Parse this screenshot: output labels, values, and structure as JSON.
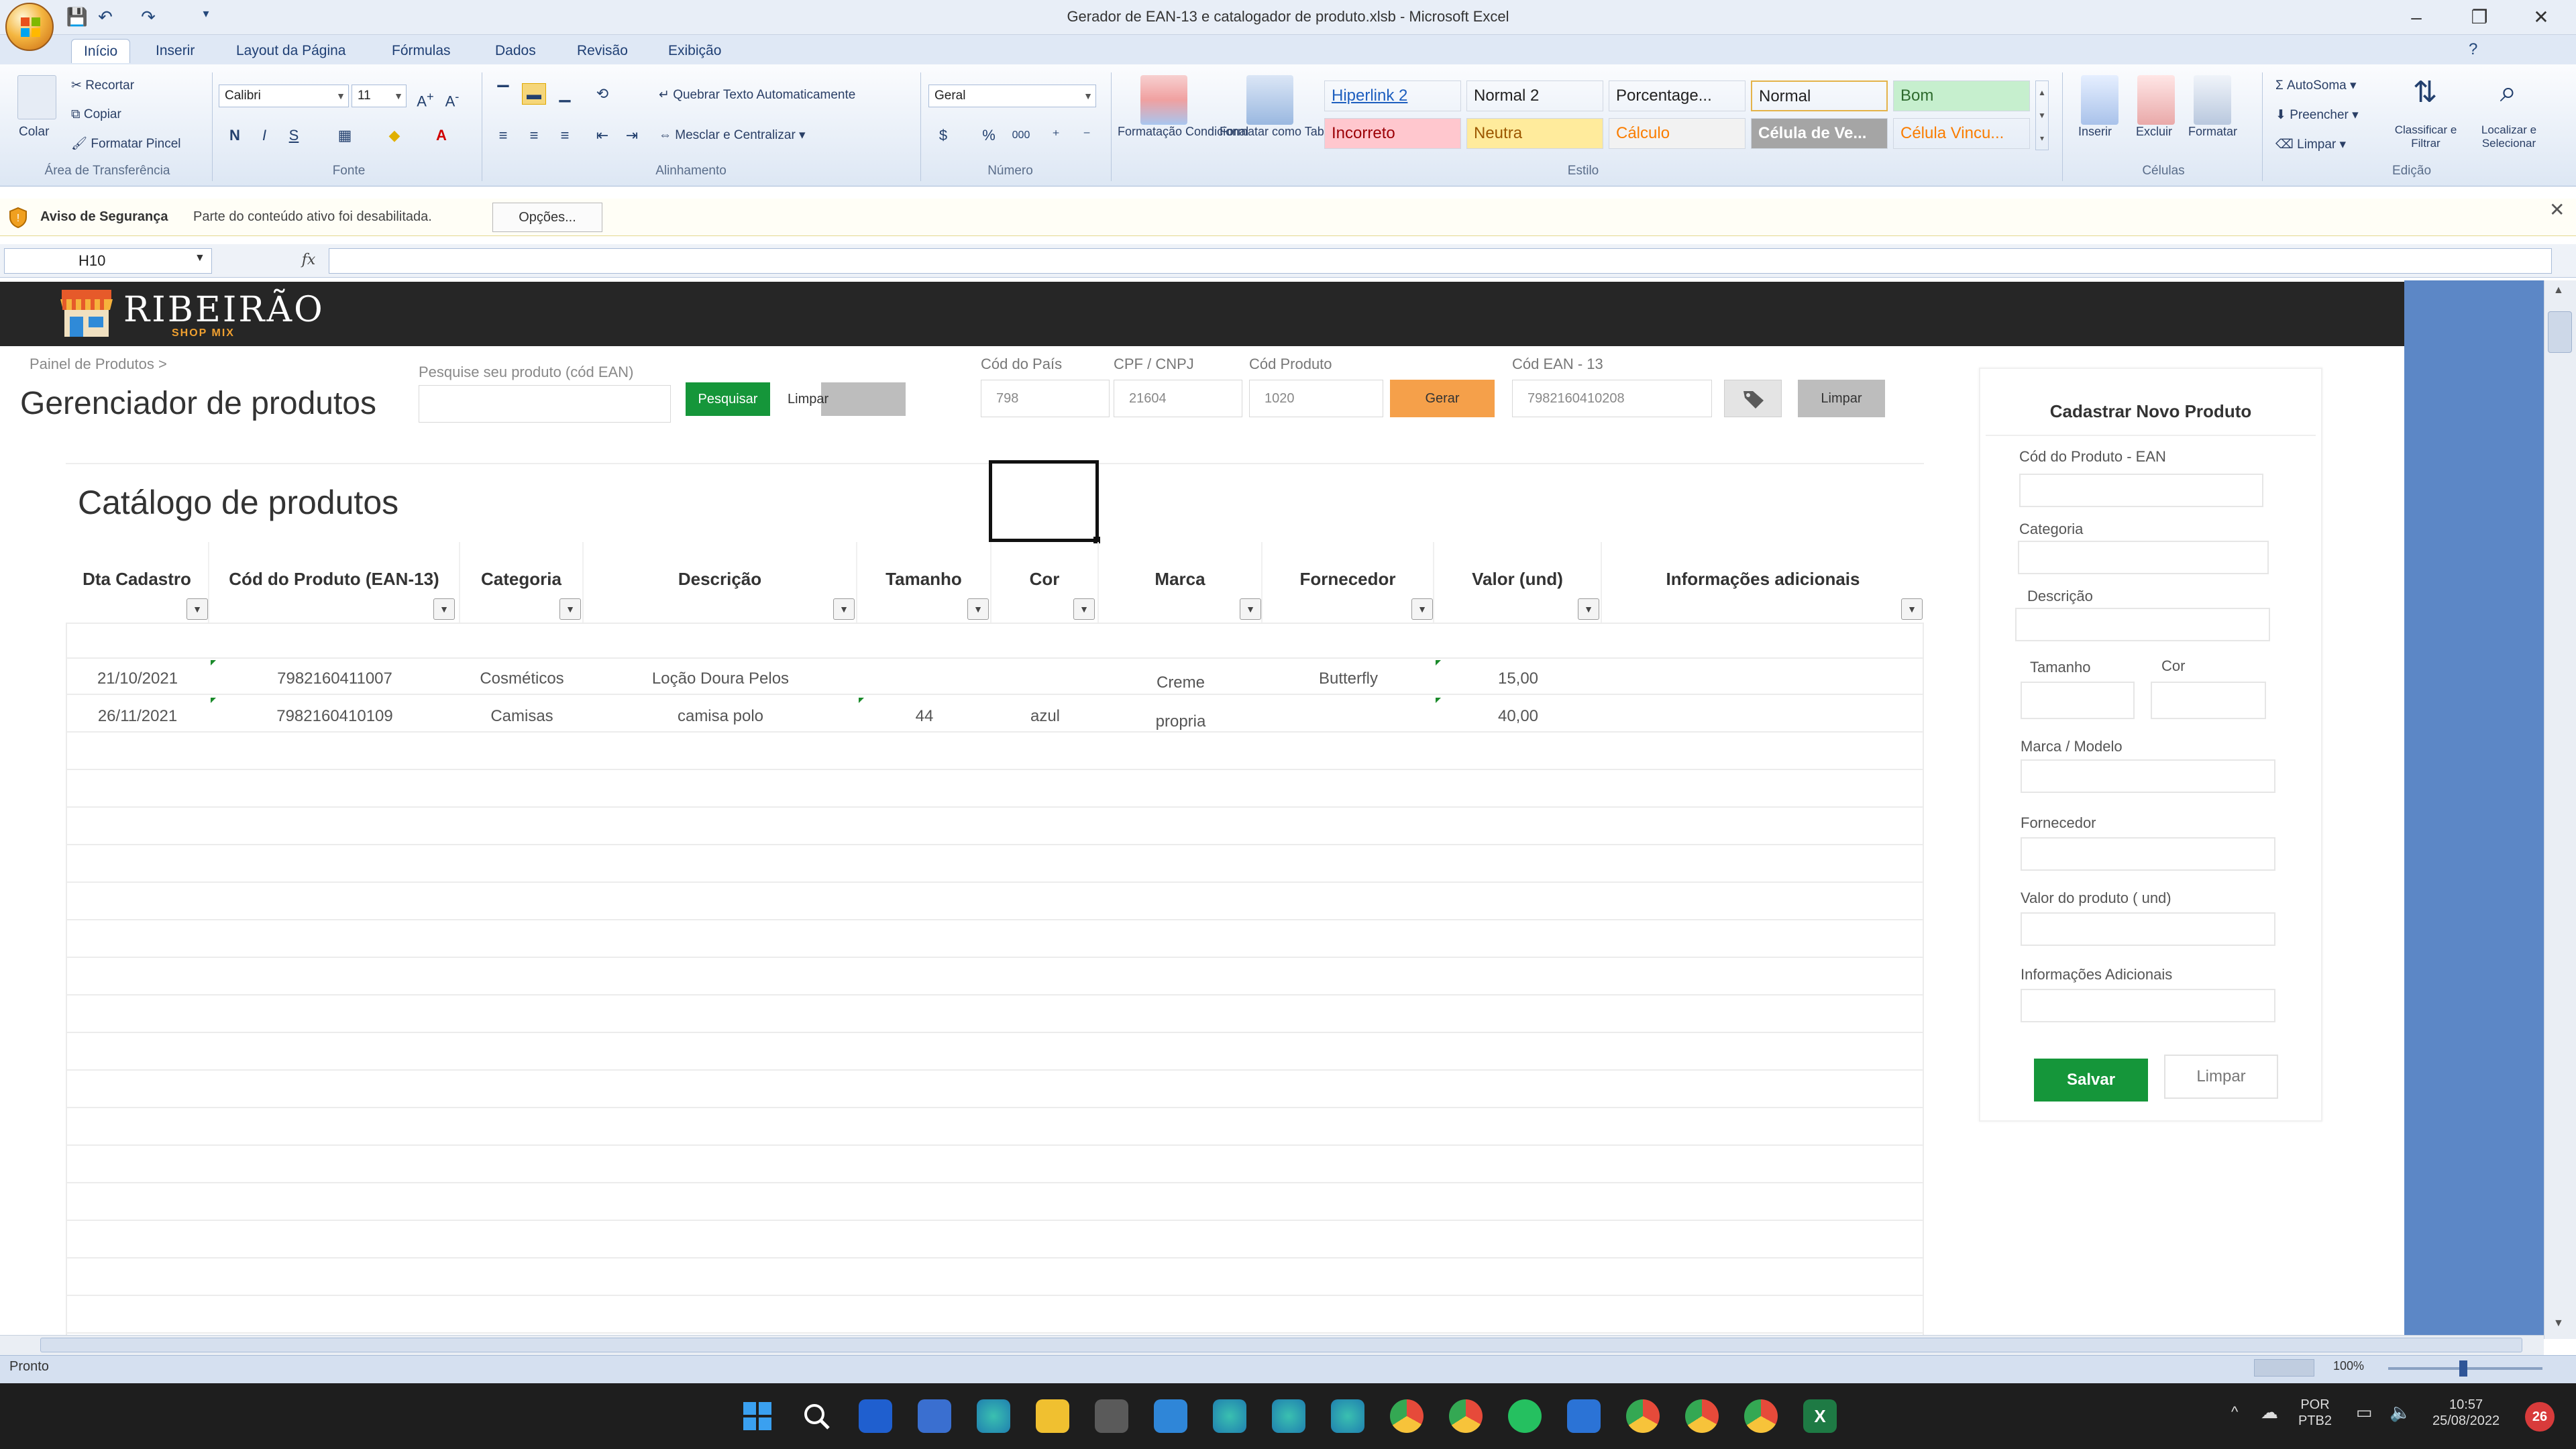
{
  "window": {
    "title": "Gerador de EAN-13 e catalogador de produto.xlsb - Microsoft Excel",
    "minimize": "–",
    "restore": "❐",
    "close": "✕"
  },
  "menu": {
    "tabs": [
      "Início",
      "Inserir",
      "Layout da Página",
      "Fórmulas",
      "Dados",
      "Revisão",
      "Exibição"
    ],
    "active_index": 0
  },
  "ribbon": {
    "clipboard": {
      "paste": "Colar",
      "cut": "Recortar",
      "copy": "Copiar",
      "format_painter": "Formatar Pincel",
      "group": "Área de Transferência"
    },
    "font": {
      "name": "Calibri",
      "size": "11",
      "group": "Fonte",
      "bold": "N",
      "italic": "I",
      "underline": "S"
    },
    "alignment": {
      "wrap": "Quebrar Texto Automaticamente",
      "merge": "Mesclar e Centralizar",
      "group": "Alinhamento"
    },
    "number": {
      "format": "Geral",
      "currency": "$",
      "percent": "%",
      "thousands": "000",
      "group": "Número"
    },
    "styles": {
      "conditional": "Formatação Condicional",
      "as_table": "Formatar como Tabela",
      "items": [
        {
          "label": "Hiperlink 2",
          "bg": "#ffffff",
          "fg": "#1e5fbf"
        },
        {
          "label": "Normal 2",
          "bg": "#ffffff",
          "fg": "#222222"
        },
        {
          "label": "Porcentage...",
          "bg": "#ffffff",
          "fg": "#222222"
        },
        {
          "label": "Normal",
          "bg": "#ffffff",
          "fg": "#222222"
        },
        {
          "label": "Bom",
          "bg": "#c6efce",
          "fg": "#2e6b2e"
        },
        {
          "label": "Incorreto",
          "bg": "#ffc7ce",
          "fg": "#9c0006"
        },
        {
          "label": "Neutra",
          "bg": "#ffeb9c",
          "fg": "#9c5700"
        },
        {
          "label": "Cálculo",
          "bg": "#f2f2f2",
          "fg": "#fa7d00"
        },
        {
          "label": "Célula de Ve...",
          "bg": "#a5a5a5",
          "fg": "#ffffff"
        },
        {
          "label": "Célula Vincu...",
          "bg": "#ffffff",
          "fg": "#fa7d00"
        }
      ],
      "group": "Estilo"
    },
    "cells": {
      "insert": "Inserir",
      "delete": "Excluir",
      "format": "Formatar",
      "group": "Células"
    },
    "editing": {
      "autosum": "AutoSoma",
      "fill": "Preencher",
      "clear": "Limpar",
      "sort": "Classificar e Filtrar",
      "find": "Localizar e Selecionar",
      "group": "Edição"
    }
  },
  "security": {
    "title": "Aviso de Segurança",
    "message": "Parte do conteúdo ativo foi desabilitada.",
    "options": "Opções..."
  },
  "formula_bar": {
    "name_box": "H10",
    "fx": "fx",
    "value": ""
  },
  "app": {
    "logo": "RIBEIRÃO",
    "logo_sub": "SHOP MIX",
    "breadcrumb": "Painel de Produtos >",
    "page_title": "Gerenciador de produtos",
    "search": {
      "label": "Pesquise seu produto (cód EAN)",
      "value": "",
      "search_button": "Pesquisar",
      "clear_button": "Limpar"
    },
    "generator": {
      "country_label": "Cód do País",
      "country_value": "798",
      "cpf_label": "CPF / CNPJ",
      "cpf_value": "21604",
      "product_label": "Cód Produto",
      "product_value": "1020",
      "generate_button": "Gerar",
      "ean_label": "Cód EAN - 13",
      "ean_value": "7982160410208",
      "clear_button": "Limpar"
    },
    "catalog": {
      "title": "Catálogo de produtos",
      "columns": [
        "Dta Cadastro",
        "Cód do Produto (EAN-13)",
        "Categoria",
        "Descrição",
        "Tamanho",
        "Cor",
        "Marca",
        "Fornecedor",
        "Valor (und)",
        "Informações adicionais"
      ],
      "rows": [
        [
          "21/10/2021",
          "7982160411007",
          "Cosméticos",
          "Loção Doura Pelos",
          "",
          "",
          "Creme",
          "Butterfly",
          "15,00",
          ""
        ],
        [
          "26/11/2021",
          "7982160410109",
          "Camisas",
          "camisa polo",
          "44",
          "azul",
          "propria",
          "",
          "40,00",
          ""
        ]
      ]
    },
    "side_form": {
      "title": "Cadastrar Novo Produto",
      "fields": [
        "Cód do Produto - EAN",
        "Categoria",
        "Descrição",
        "Tamanho",
        "Cor",
        "Marca / Modelo",
        "Fornecedor",
        "Valor do produto ( und)",
        "Informações Adicionais"
      ],
      "save_button": "Salvar",
      "clear_button": "Limpar"
    }
  },
  "statusbar": {
    "status": "Pronto",
    "zoom": "100%"
  },
  "taskbar": {
    "language": "POR",
    "language_sub": "PTB2",
    "time": "10:57",
    "date": "25/08/2022",
    "badge": "26"
  },
  "colors": {
    "accent_green": "#15963a",
    "accent_orange": "#f5a04a",
    "header_dark": "#262626"
  }
}
